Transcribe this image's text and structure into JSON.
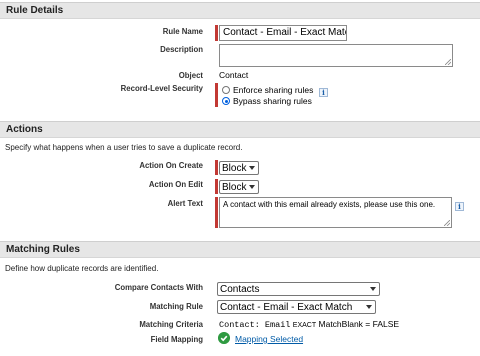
{
  "rule_details": {
    "header": "Rule Details",
    "rule_name_label": "Rule Name",
    "rule_name_value": "Contact - Email - Exact Matc",
    "description_label": "Description",
    "object_label": "Object",
    "object_value": "Contact",
    "security_label": "Record-Level Security",
    "security_options": [
      "Enforce sharing rules",
      "Bypass sharing rules"
    ],
    "security_selected": "Bypass sharing rules",
    "info_icon": "info-icon"
  },
  "actions": {
    "header": "Actions",
    "description": "Specify what happens when a user tries to save a duplicate record.",
    "on_create_label": "Action On Create",
    "on_create_value": "Block",
    "on_edit_label": "Action On Edit",
    "on_edit_value": "Block",
    "alert_label": "Alert Text",
    "alert_value": "A contact with this email already exists, please use this one."
  },
  "matching": {
    "header": "Matching Rules",
    "description": "Define how duplicate records are identified.",
    "compare_label": "Compare Contacts With",
    "compare_value": "Contacts",
    "rule_label": "Matching Rule",
    "rule_value": "Contact - Email - Exact Match",
    "criteria_label": "Matching Criteria",
    "criteria_field": "Contact: Email",
    "criteria_op": "EXACT",
    "criteria_rest": "MatchBlank = FALSE",
    "mapping_label": "Field Mapping",
    "mapping_value": "Mapping Selected"
  },
  "colors": {
    "required_bar": "#c23934",
    "link": "#015ba7",
    "success": "#2f9a41",
    "header_bg": "#e6e6e6"
  }
}
